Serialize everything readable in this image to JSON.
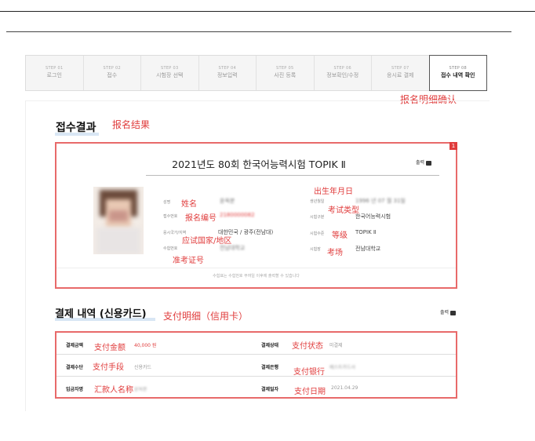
{
  "steps": [
    {
      "num": "STEP 01",
      "label": "로그인"
    },
    {
      "num": "STEP 02",
      "label": "접수"
    },
    {
      "num": "STEP 03",
      "label": "시험장 선택"
    },
    {
      "num": "STEP 04",
      "label": "정보입력"
    },
    {
      "num": "STEP 05",
      "label": "사진 등록"
    },
    {
      "num": "STEP 06",
      "label": "정보확인/수정"
    },
    {
      "num": "STEP 07",
      "label": "응시료 결제"
    },
    {
      "num": "STEP 08",
      "label": "접수 내역 확인"
    }
  ],
  "annotations": {
    "step_confirm": "报名明细确认",
    "result": "报名结果",
    "payment": "支付明细（信用卡）",
    "name": "姓名",
    "reg_no": "报名编号",
    "country": "应试国家/地区",
    "ticket": "准考证号",
    "birth": "出生年月日",
    "exam_type": "考试类型",
    "level": "等级",
    "site": "考场",
    "amount": "支付金额",
    "method": "支付手段",
    "payer": "汇款人名称",
    "status": "支付状态",
    "bank": "支付银行",
    "date": "支付日期"
  },
  "result": {
    "heading": "접수결과",
    "badge": "1",
    "title": "2021년도 80회 한국어능력시험 TOPIK Ⅱ",
    "print_label": "출력",
    "fields": {
      "name_label": "성명",
      "name_value": "윤옥분",
      "reg_label": "접수번호",
      "reg_value": "2180000082",
      "country_label": "응시국가/지역",
      "country_value": "대한민국 / 광주(전남대)",
      "ticket_label": "수험번호",
      "ticket_value": "전남대학교",
      "birth_label": "생년월일",
      "birth_value": "1996 년 07 월 31일",
      "type_label": "시험구분",
      "type_value": "한국어능력시험",
      "level_label": "시험수준",
      "level_value": "TOPIK Ⅱ",
      "site_label": "시험장",
      "site_value": "전남대학교"
    },
    "note": "수험표는 수험번호 부여일 이후에 출력할 수 있습니다"
  },
  "payment": {
    "heading": "결제 내역 (신용카드)",
    "print_label": "출력",
    "rows": [
      {
        "l_label": "결제금액",
        "l_value": "40,000 원",
        "r_label": "결제상태",
        "r_value": "미결제"
      },
      {
        "l_label": "결제수단",
        "l_value": "신용카드",
        "r_label": "결제은행",
        "r_value": "베스트카드사"
      },
      {
        "l_label": "입금자명",
        "l_value": "윤옥분",
        "r_label": "결제일자",
        "r_value": "2021.04.29"
      }
    ]
  },
  "colors": {
    "accent_red": "#e03c3c",
    "card_border": "#e86a6a",
    "underline": "#d8e6f4"
  }
}
